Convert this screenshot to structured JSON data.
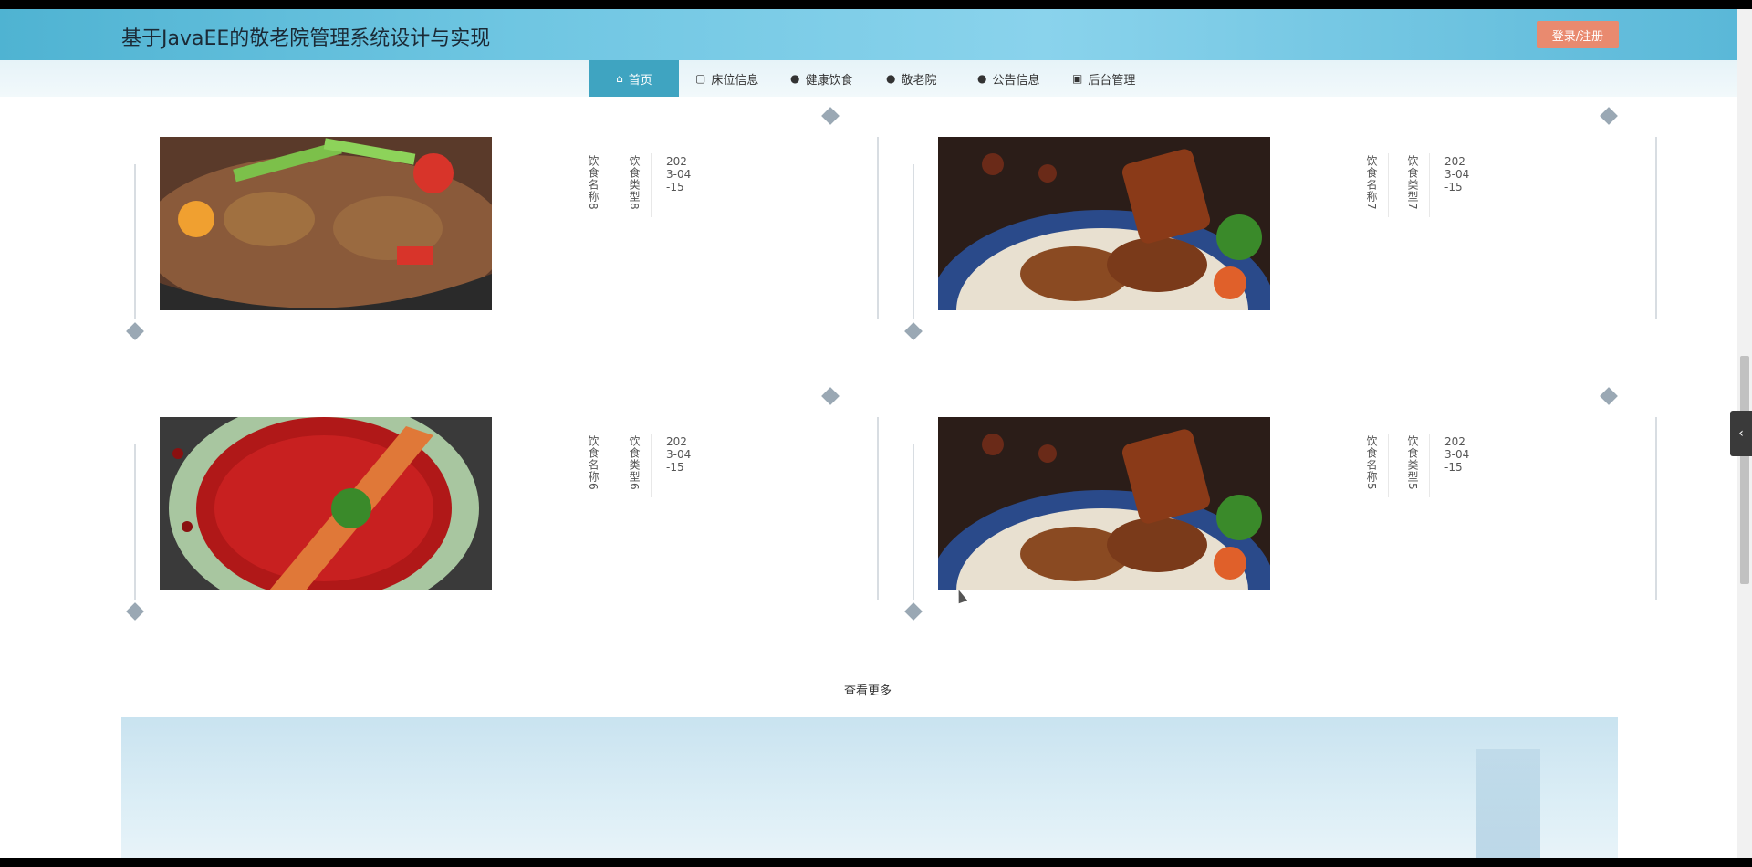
{
  "header": {
    "title": "基于JavaEE的敬老院管理系统设计与实现",
    "login_label": "登录/注册"
  },
  "nav": [
    {
      "label": "首页",
      "icon": "home-icon"
    },
    {
      "label": "床位信息",
      "icon": "bed-icon"
    },
    {
      "label": "健康饮食",
      "icon": "info-icon"
    },
    {
      "label": "敬老院",
      "icon": "question-icon"
    },
    {
      "label": "公告信息",
      "icon": "info-icon"
    },
    {
      "label": "后台管理",
      "icon": "calendar-icon"
    }
  ],
  "cards": [
    {
      "name_text": "饮食名称8",
      "type_text": "饮食类型8",
      "date_text": "2023-04-15",
      "image": "stir-fry-dish"
    },
    {
      "name_text": "饮食名称7",
      "type_text": "饮食类型7",
      "date_text": "2023-04-15",
      "image": "grilled-meat-dish"
    },
    {
      "name_text": "饮食名称6",
      "type_text": "饮食类型6",
      "date_text": "2023-04-15",
      "image": "spicy-lobster-dish"
    },
    {
      "name_text": "饮食名称5",
      "type_text": "饮食类型5",
      "date_text": "2023-04-15",
      "image": "grilled-meat-dish"
    }
  ],
  "more_label": "查看更多",
  "colors": {
    "header_accent": "#4fb3d2",
    "nav_active": "#3fa4c1",
    "login_button": "#e98a6f"
  }
}
